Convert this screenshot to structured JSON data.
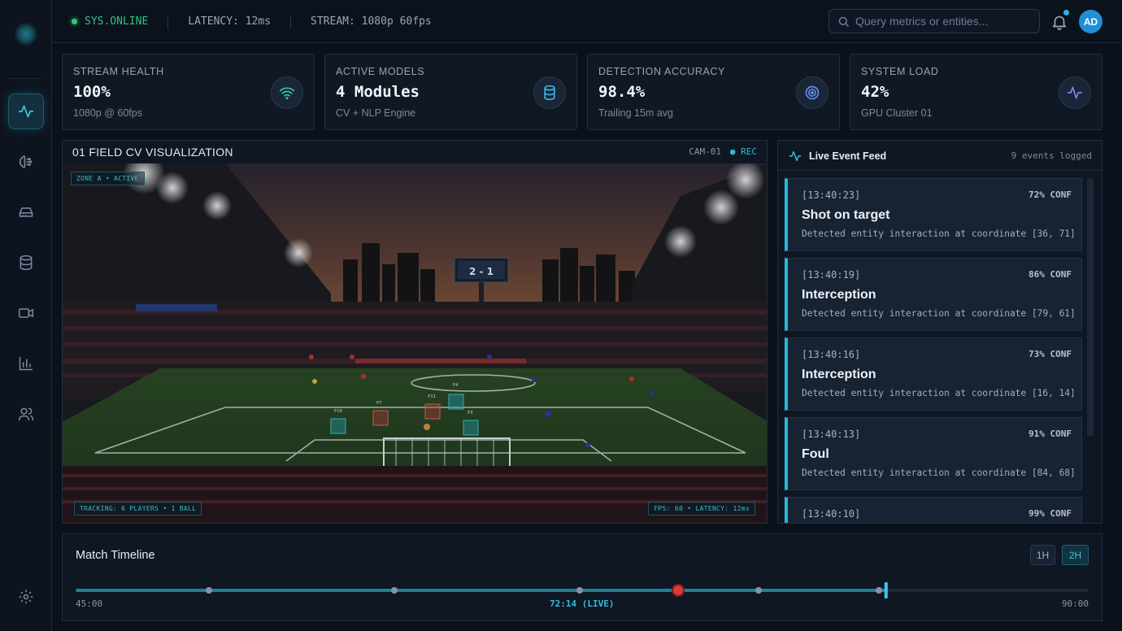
{
  "sidebar": {
    "items": [
      {
        "name": "activity",
        "active": true
      },
      {
        "name": "brain",
        "active": false
      },
      {
        "name": "storage",
        "active": false
      },
      {
        "name": "database",
        "active": false
      },
      {
        "name": "video",
        "active": false
      },
      {
        "name": "analytics",
        "active": false
      },
      {
        "name": "users",
        "active": false
      }
    ],
    "settings_icon": "gear-icon"
  },
  "topbar": {
    "status": "SYS.ONLINE",
    "latency": "LATENCY: 12ms",
    "stream": "STREAM: 1080p 60fps",
    "search_placeholder": "Query metrics or entities...",
    "avatar_initials": "AD"
  },
  "cards": [
    {
      "label": "STREAM HEALTH",
      "value": "100%",
      "sub": "1080p @ 60fps",
      "icon": "wifi-icon",
      "color": "#2fd3a0"
    },
    {
      "label": "ACTIVE MODELS",
      "value": "4 Modules",
      "sub": "CV + NLP Engine",
      "icon": "database-icon",
      "color": "#3cb4e6"
    },
    {
      "label": "DETECTION ACCURACY",
      "value": "98.4%",
      "sub": "Trailing 15m avg",
      "icon": "target-icon",
      "color": "#5d8ef0"
    },
    {
      "label": "SYSTEM LOAD",
      "value": "42%",
      "sub": "GPU Cluster 01",
      "icon": "pulse-icon",
      "color": "#8b7ff2"
    }
  ],
  "video": {
    "title": "01 FIELD CV VISUALIZATION",
    "camera": "CAM-01",
    "rec": "● REC",
    "zone_tag": "ZONE A • ACTIVE",
    "tracking_tag": "TRACKING: 6 PLAYERS • 1 BALL",
    "fps_tag": "FPS: 60 • LATENCY: 12ms",
    "scoreboard": "2 - 1",
    "player_tags": [
      "P10",
      "P7",
      "P11",
      "P4",
      "P3"
    ]
  },
  "feed": {
    "title": "Live Event Feed",
    "count": "9 events logged",
    "events": [
      {
        "time": "[13:40:23]",
        "conf": "72% CONF",
        "title": "Shot on target",
        "desc": "Detected entity interaction at coordinate [36, 71]"
      },
      {
        "time": "[13:40:19]",
        "conf": "86% CONF",
        "title": "Interception",
        "desc": "Detected entity interaction at coordinate [79, 61]"
      },
      {
        "time": "[13:40:16]",
        "conf": "73% CONF",
        "title": "Interception",
        "desc": "Detected entity interaction at coordinate [16, 14]"
      },
      {
        "time": "[13:40:13]",
        "conf": "91% CONF",
        "title": "Foul",
        "desc": "Detected entity interaction at coordinate [84, 68]"
      },
      {
        "time": "[13:40:10]",
        "conf": "99% CONF",
        "title": "",
        "desc": ""
      }
    ]
  },
  "timeline": {
    "title": "Match Timeline",
    "btn_1h": "1H",
    "btn_2h": "2H",
    "start_label": "45:00",
    "current_label": "72:14 (LIVE)",
    "end_label": "90:00",
    "progress": 0.8
  }
}
